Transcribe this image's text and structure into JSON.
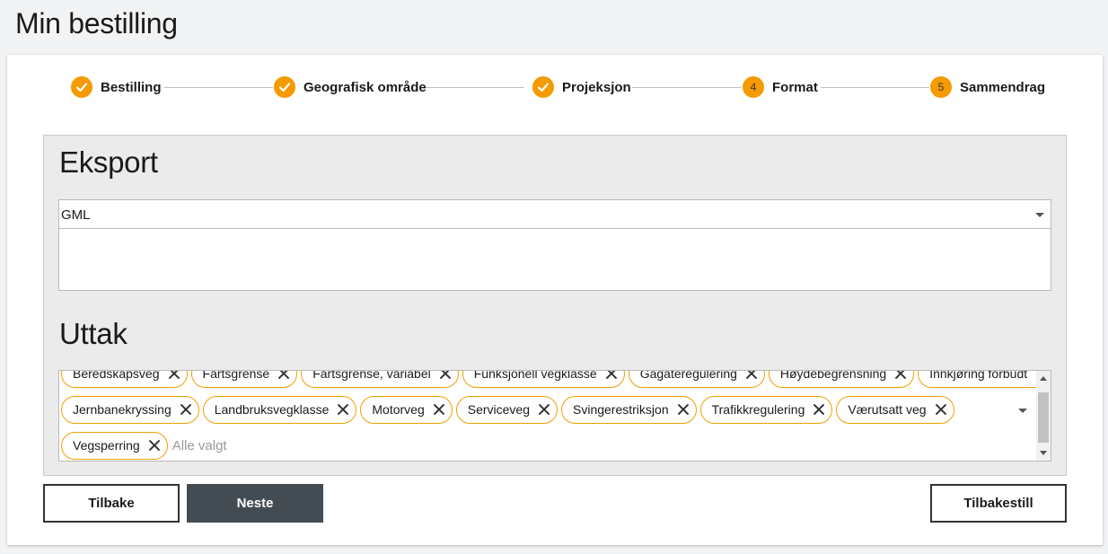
{
  "page": {
    "title": "Min bestilling"
  },
  "stepper": {
    "steps": [
      {
        "label": "Bestilling",
        "status": "done",
        "number": "1"
      },
      {
        "label": "Geografisk område",
        "status": "done",
        "number": "2"
      },
      {
        "label": "Projeksjon",
        "status": "done",
        "number": "3"
      },
      {
        "label": "Format",
        "status": "current",
        "number": "4"
      },
      {
        "label": "Sammendrag",
        "status": "pending",
        "number": "5"
      }
    ],
    "accent_color": "#f59a00"
  },
  "export": {
    "heading": "Eksport",
    "format_value": "GML"
  },
  "uttak": {
    "heading": "Uttak",
    "chips_row1": [
      "Beredskapsveg",
      "Fartsgrense",
      "Fartsgrense, variabel",
      "Funksjonell vegklasse",
      "Gagateregulering",
      "Høydebegrensning",
      "Innkjøring forbudt"
    ],
    "chips_row2": [
      "Jernbanekryssing",
      "Landbruksvegklasse",
      "Motorveg",
      "Serviceveg",
      "Svingerestriksjon",
      "Trafikkregulering",
      "Værutsatt veg"
    ],
    "chips_row3": [
      "Vegsperring"
    ],
    "placeholder": "Alle valgt",
    "chip_border_color": "#f0a000"
  },
  "buttons": {
    "back": "Tilbake",
    "next": "Neste",
    "reset": "Tilbakestill"
  },
  "icons": {
    "step_done": "check-icon",
    "chip_remove": "close-icon",
    "dropdown": "chevron-down-icon"
  }
}
